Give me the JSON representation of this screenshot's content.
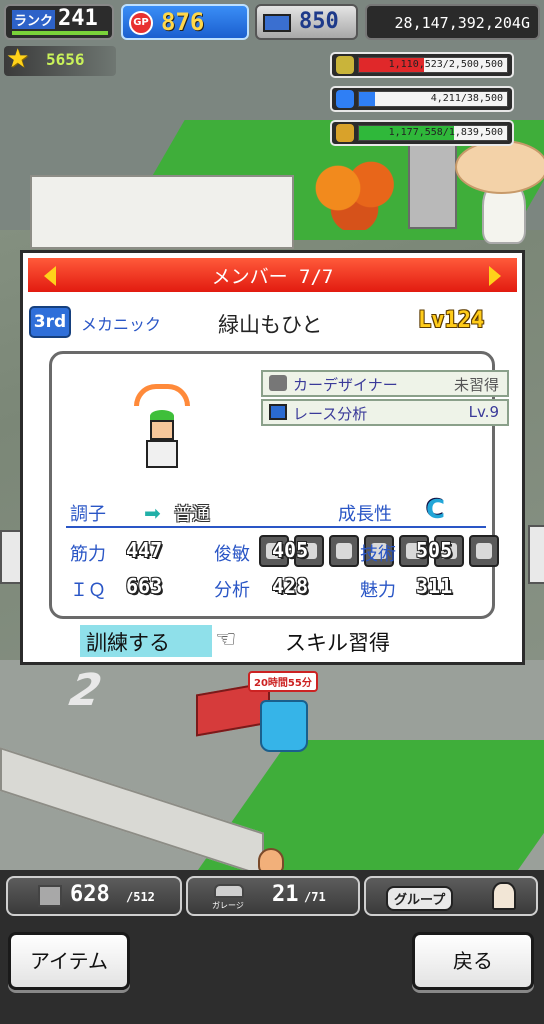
{
  "hud": {
    "rank_label": "ランク",
    "rank_value": "241",
    "gp_icon": "GP",
    "gp_value": "876",
    "pc_value": "850",
    "money": "28,147,392,204G",
    "stars": "5656"
  },
  "resources": [
    {
      "icon": "coin-stack-icon",
      "current": "1,110,523",
      "max": "2,500,500",
      "text": "1,110,523/2,500,500",
      "fill": 0.44,
      "color": "#e0282a"
    },
    {
      "icon": "fuel-icon",
      "current": "4,211",
      "max": "38,500",
      "text": "4,211/38,500",
      "fill": 0.11,
      "color": "#2f7ff5"
    },
    {
      "icon": "wheat-icon",
      "current": "1,177,558",
      "max": "1,839,500",
      "text": "1,177,558/1,839,500",
      "fill": 0.64,
      "color": "#2fb83a"
    }
  ],
  "scene": {
    "timer": "20時間55分",
    "lot_number": "2"
  },
  "dialog": {
    "title": "メンバー 7/7",
    "rank_badge": "3rd",
    "job": "メカニック",
    "name": "緑山もひと",
    "level": "Lv124",
    "skills": [
      {
        "name": "カーデザイナー",
        "value": "未習得",
        "icon": "wrench-icon"
      },
      {
        "name": "レース分析",
        "value": "Lv.9",
        "icon": "monitor-icon"
      }
    ],
    "equip_slots": [
      "engine-slot-icon",
      "body-slot-icon",
      "gear-slot-icon",
      "helmet-slot-icon",
      "cap-slot-icon",
      "tool-slot-icon",
      "tire-slot-icon"
    ],
    "condition_label": "調子",
    "condition_value": "普通",
    "growth_label": "成長性",
    "growth_value": "C",
    "stats": [
      {
        "label": "筋力",
        "value": "447"
      },
      {
        "label": "俊敏",
        "value": "405"
      },
      {
        "label": "技術",
        "value": "505"
      },
      {
        "label": "ＩＱ",
        "value": "663"
      },
      {
        "label": "分析",
        "value": "428"
      },
      {
        "label": "魅力",
        "value": "311"
      }
    ],
    "train_label": "訓練する",
    "skill_learn_label": "スキル習得"
  },
  "bottom": {
    "inventory": "628",
    "inventory_max": "/512",
    "garage_label": "ガレージ",
    "garage": "21",
    "garage_max": "/71",
    "group_label": "グループ",
    "item_button": "アイテム",
    "back_button": "戻る"
  },
  "colors": {
    "header_red": "#e21b10",
    "stat_blue": "#2a56c6",
    "growth_c": "#22a6d8"
  }
}
